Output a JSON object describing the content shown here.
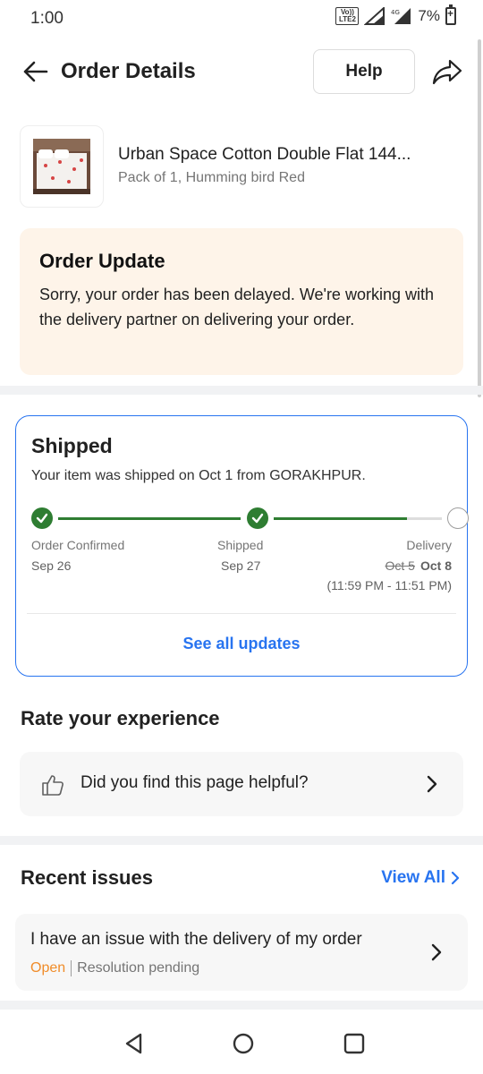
{
  "status_bar": {
    "time": "1:00",
    "volte_label_1": "Vo))",
    "volte_label_2": "LTE2",
    "network": "4G",
    "battery": "7%"
  },
  "header": {
    "title": "Order Details",
    "help_label": "Help"
  },
  "product": {
    "name": "Urban Space Cotton Double Flat 144...",
    "variant": "Pack of 1, Humming bird Red"
  },
  "order_update": {
    "title": "Order Update",
    "message": "Sorry, your order has been delayed. We're working with the delivery partner on delivering your order."
  },
  "shipment": {
    "title": "Shipped",
    "subtitle": "Your item was shipped on Oct 1 from GORAKHPUR.",
    "stages": [
      {
        "label": "Order Confirmed",
        "date": "Sep 26",
        "done": true
      },
      {
        "label": "Shipped",
        "date": "Sep 27",
        "done": true
      },
      {
        "label": "Delivery",
        "old_date": "Oct 5",
        "date": "Oct 8",
        "time_window": "(11:59 PM - 11:51 PM)",
        "done": false
      }
    ],
    "see_all_label": "See all updates"
  },
  "rate": {
    "title": "Rate your experience",
    "prompt": "Did you find this page helpful?"
  },
  "recent_issues": {
    "title": "Recent issues",
    "view_all_label": "View All",
    "items": [
      {
        "text": "I have an issue with the delivery of my order",
        "status": "Open",
        "resolution": "Resolution pending"
      }
    ]
  },
  "colors": {
    "accent": "#2874f0",
    "success": "#2e7d32",
    "open": "#f08c29",
    "update_bg": "#fef4e9"
  }
}
